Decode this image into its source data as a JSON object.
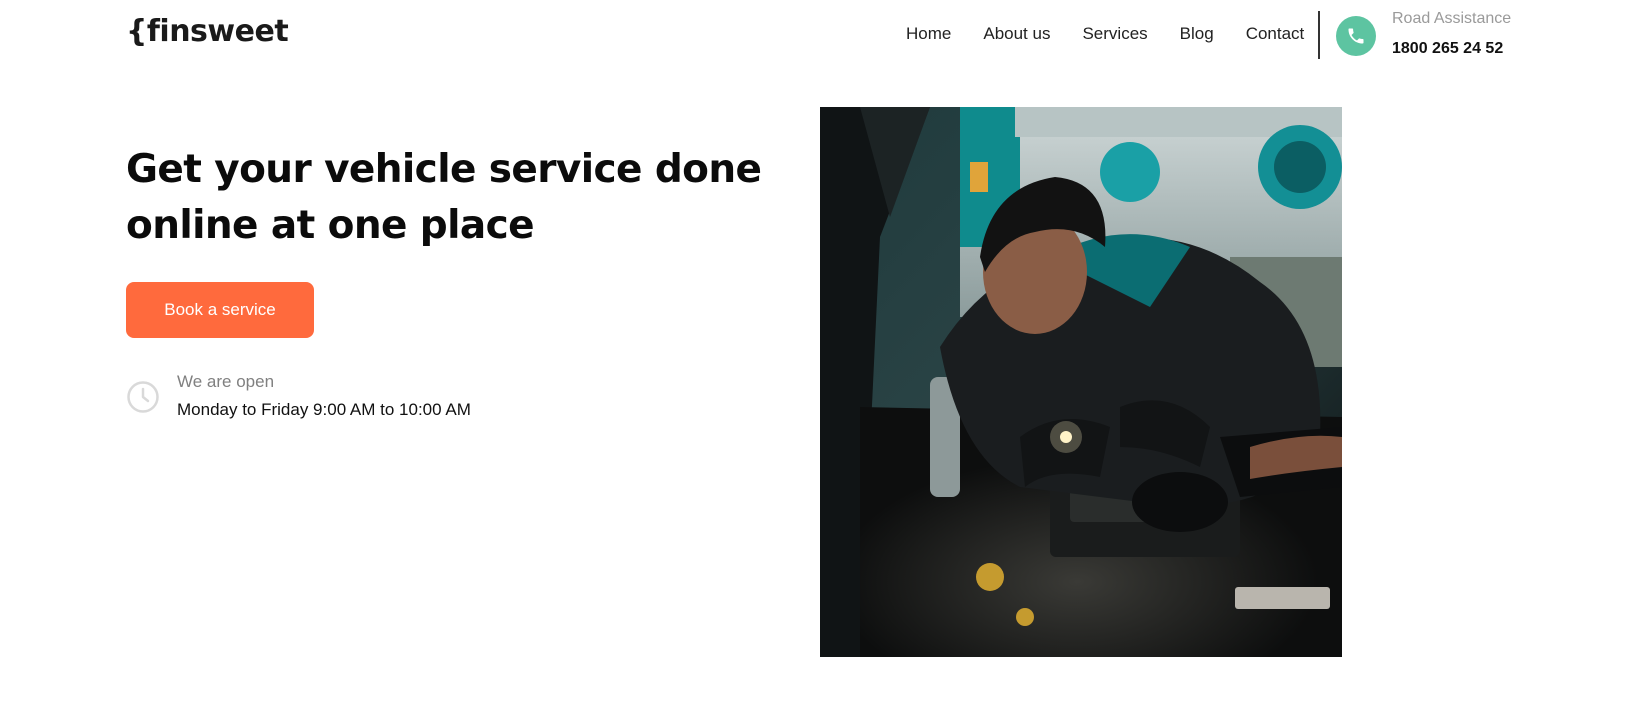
{
  "header": {
    "logo": "{finsweet",
    "nav": [
      "Home",
      "About us",
      "Services",
      "Blog",
      "Contact"
    ],
    "assistance_label": "Road Assistance",
    "assistance_number": "1800 265 24 52",
    "phone_icon": "phone-icon"
  },
  "hero": {
    "headline_line1": "Get your vehicle service done",
    "headline_line2": "online at one place",
    "cta_label": "Book a service",
    "open_label": "We are open",
    "open_hours": "Monday to Friday 9:00 AM to 10:00 AM",
    "clock_icon": "clock-icon",
    "image_alt": "Mechanic working on car engine"
  },
  "colors": {
    "accent": "#ff6a3d",
    "phone_badge": "#5dc4a1",
    "text_dark": "#111111",
    "text_muted": "#808080"
  }
}
